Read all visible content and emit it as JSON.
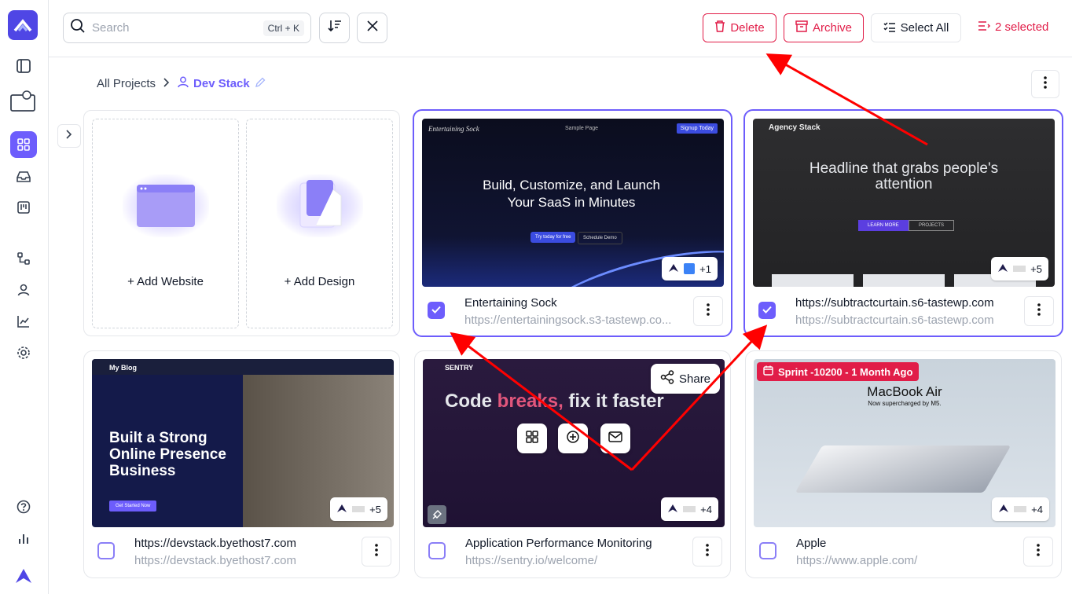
{
  "search": {
    "placeholder": "Search",
    "shortcut": "Ctrl + K"
  },
  "toolbar": {
    "delete_label": "Delete",
    "archive_label": "Archive",
    "select_all_label": "Select All",
    "selected_count": "2 selected"
  },
  "breadcrumb": {
    "root": "All Projects",
    "current": "Dev Stack"
  },
  "add_cards": {
    "website": "+ Add Website",
    "design": "+ Add Design"
  },
  "cards": [
    {
      "title": "Entertaining Sock",
      "url": "https://entertainingsock.s3-tastewp.co...",
      "checked": true,
      "badge": "+1",
      "thumb_brand": "Entertaining Sock",
      "thumb_nav": "Sample Page",
      "thumb_cta": "Signup Today",
      "thumb_headline": "Build, Customize, and Launch Your SaaS in Minutes",
      "thumb_btn1": "Try today for free",
      "thumb_btn2": "Schedule Demo"
    },
    {
      "title": "https://subtractcurtain.s6-tastewp.com",
      "url": "https://subtractcurtain.s6-tastewp.com",
      "checked": true,
      "badge": "+5",
      "thumb_brand": "Agency Stack",
      "thumb_headline": "Headline that grabs people's attention",
      "thumb_btn1": "LEARN MORE",
      "thumb_btn2": "PROJECTS"
    },
    {
      "title": "https://devstack.byethost7.com",
      "url": "https://devstack.byethost7.com",
      "checked": false,
      "badge": "+5",
      "thumb_brand": "My Blog",
      "thumb_headline": "Built a Strong Online Presence Business",
      "thumb_btn1": "Get Started Now"
    },
    {
      "title": "Application Performance Monitoring",
      "url": "https://sentry.io/welcome/",
      "checked": false,
      "badge": "+4",
      "thumb_brand": "SENTRY",
      "thumb_headline": "Code breaks, fix it faster",
      "share_label": "Share"
    },
    {
      "title": "Apple",
      "url": "https://www.apple.com/",
      "checked": false,
      "badge": "+4",
      "sprint_label": "Sprint -10200 - 1 Month Ago",
      "thumb_headline": "MacBook Air",
      "thumb_sub": "Now supercharged by M5."
    }
  ],
  "colors": {
    "accent": "#6d5dfc",
    "danger": "#e11d48",
    "arrow": "#ff0000"
  }
}
